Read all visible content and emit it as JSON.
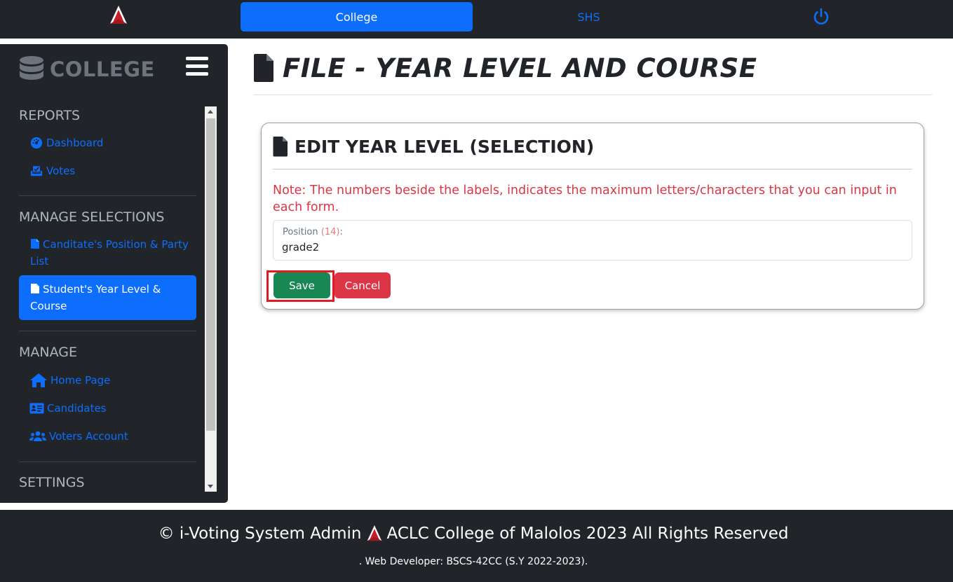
{
  "topbar": {
    "tabs": [
      {
        "label": "College",
        "active": true
      },
      {
        "label": "SHS",
        "active": false
      }
    ],
    "accent_color": "#0d6efd",
    "logout_icon": "power-icon"
  },
  "sidebar": {
    "brand": "COLLEGE",
    "sections": [
      {
        "title": "REPORTS",
        "items": [
          {
            "label": "Dashboard",
            "icon": "dashboard-gauge-icon"
          },
          {
            "label": "Votes",
            "icon": "ballot-box-icon"
          }
        ]
      },
      {
        "title": "MANAGE SELECTIONS",
        "items": [
          {
            "label": "Canditate's Position & Party List",
            "icon": "file-icon"
          },
          {
            "label": "Student's Year Level & Course",
            "icon": "file-icon",
            "active": true
          }
        ]
      },
      {
        "title": "MANAGE",
        "items": [
          {
            "label": "Home Page",
            "icon": "home-icon"
          },
          {
            "label": "Candidates",
            "icon": "id-card-icon"
          },
          {
            "label": "Voters Account",
            "icon": "users-icon"
          }
        ]
      },
      {
        "title": "SETTINGS",
        "items": []
      }
    ]
  },
  "main": {
    "page_title": "FILE - YEAR LEVEL AND COURSE",
    "card": {
      "title": "EDIT YEAR LEVEL (SELECTION)",
      "note": "Note: The numbers beside the labels, indicates the maximum letters/characters that you can input in each form.",
      "field": {
        "label": "Position",
        "max": "(14)",
        "suffix": ":",
        "value": "grade2"
      },
      "save_label": "Save",
      "cancel_label": "Cancel"
    }
  },
  "footer": {
    "copyright_left": "© i-Voting System Admin",
    "copyright_right": "ACLC College of Malolos 2023 All Rights Reserved",
    "developer": ". Web Developer: BSCS-42CC (S.Y 2022-2023)."
  },
  "colors": {
    "dark": "#212529",
    "primary": "#0d6efd",
    "success": "#198754",
    "danger": "#dc3545",
    "highlight_outline": "#e01b24"
  }
}
